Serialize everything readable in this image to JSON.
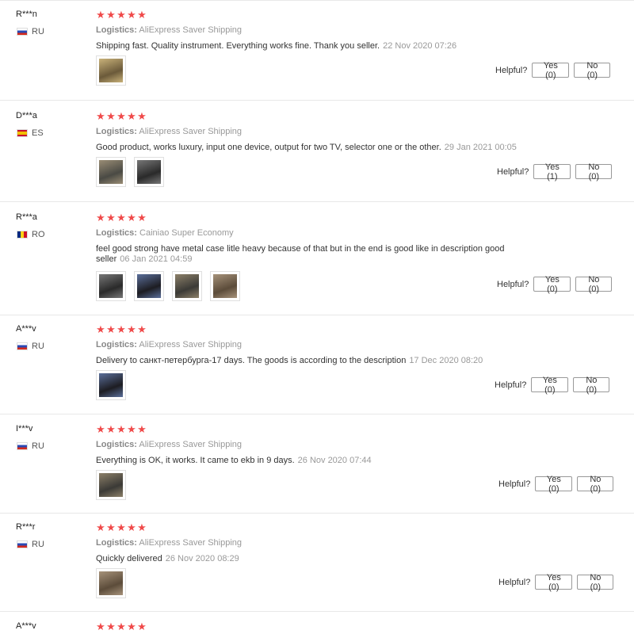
{
  "helpful_label": "Helpful?",
  "logistics_label": "Logistics:",
  "star_glyph": "★",
  "accent_color": "#f04a4a",
  "reviews": [
    {
      "name": "R***n",
      "country": "RU",
      "rating": 5,
      "logistics": "AliExpress Saver Shipping",
      "comment": "Shipping fast. Quality instrument. Everything works fine. Thank you seller.",
      "date": "22 Nov 2020 07:26",
      "yes": "Yes (0)",
      "no": "No (0)",
      "images": 1
    },
    {
      "name": "D***a",
      "country": "ES",
      "rating": 5,
      "logistics": "AliExpress Saver Shipping",
      "comment": "Good product, works luxury, input one device, output for two TV, selector one or the other.",
      "date": "29 Jan 2021 00:05",
      "yes": "Yes (1)",
      "no": "No (0)",
      "images": 2
    },
    {
      "name": "R***a",
      "country": "RO",
      "rating": 5,
      "logistics": "Cainiao Super Economy",
      "comment": "feel good strong have metal case litle heavy because of that but in the end is good like in description good seller",
      "date": "06 Jan 2021 04:59",
      "yes": "Yes (0)",
      "no": "No (0)",
      "images": 4
    },
    {
      "name": "A***v",
      "country": "RU",
      "rating": 5,
      "logistics": "AliExpress Saver Shipping",
      "comment": "Delivery to санкт-петербурга-17 days. The goods is according to the description",
      "date": "17 Dec 2020 08:20",
      "yes": "Yes (0)",
      "no": "No (0)",
      "images": 1
    },
    {
      "name": "I***v",
      "country": "RU",
      "rating": 5,
      "logistics": "AliExpress Saver Shipping",
      "comment": "Everything is OK, it works. It came to ekb in 9 days.",
      "date": "26 Nov 2020 07:44",
      "yes": "Yes (0)",
      "no": "No (0)",
      "images": 1
    },
    {
      "name": "R***r",
      "country": "RU",
      "rating": 5,
      "logistics": "AliExpress Saver Shipping",
      "comment": "Quickly delivered",
      "date": "26 Nov 2020 08:29",
      "yes": "Yes (0)",
      "no": "No (0)",
      "images": 1
    },
    {
      "name": "A***v",
      "country": "",
      "rating": 5,
      "logistics": "",
      "comment": "",
      "date": "",
      "yes": "",
      "no": "",
      "images": 0
    }
  ]
}
